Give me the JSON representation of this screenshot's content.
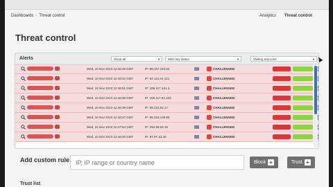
{
  "nav": {
    "breadcrumb": [
      "Dashboards",
      "Threat control"
    ],
    "right_links": [
      "Analytics",
      "Threat control"
    ]
  },
  "page_title": "Threat control",
  "alerts": {
    "label": "Alerts",
    "filters": [
      "Show all",
      "With any status",
      "Visiting any zone"
    ],
    "rows": [
      {
        "datetime": "Wed, 10 Nov 2010 12:45:26 GMT",
        "ip": "IP: 88.167.153.52",
        "status": "CHALLENGED"
      },
      {
        "datetime": "Wed, 10 Nov 2010 12:48:02 GMT",
        "ip": "IP: 62.114.44.121",
        "status": "CHALLENGED"
      },
      {
        "datetime": "Wed, 10 Nov 2010 12:48:51 GMT",
        "ip": "IP: 186.117.121.3",
        "status": "CHALLENGED"
      },
      {
        "datetime": "Wed, 10 Nov 2010 12:48:39 GMT",
        "ip": "IP: 180.117.61.242",
        "status": "CHALLENGED"
      },
      {
        "datetime": "Wed, 10 Nov 2010 12:46:38 GMT",
        "ip": "IP: 98.210.62.17",
        "status": "CHALLENGED"
      },
      {
        "datetime": "Wed, 10 Nov 2010 12:48:27 GMT",
        "ip": "IP: 96.253.148.88",
        "status": "CHALLENGED"
      },
      {
        "datetime": "Wed, 10 Nov 2010 12:47:54 GMT",
        "ip": "IP: 252.58.84.16",
        "status": "CHALLENGED"
      },
      {
        "datetime": "Wed, 10 Nov 2010 12:48:20 GMT",
        "ip": "IP: 87.97.13.40",
        "status": "CHALLENGED"
      }
    ]
  },
  "custom_rule": {
    "label": "Add custom rule",
    "placeholder": "IP, IP range or country name",
    "block_label": "Block",
    "trust_label": "Trust",
    "plus": "+"
  },
  "trust_list": {
    "label": "Trust list"
  },
  "colors": {
    "alert_row": "#f6dcdc",
    "danger": "#d23b3b",
    "ok": "#8ed24a"
  }
}
